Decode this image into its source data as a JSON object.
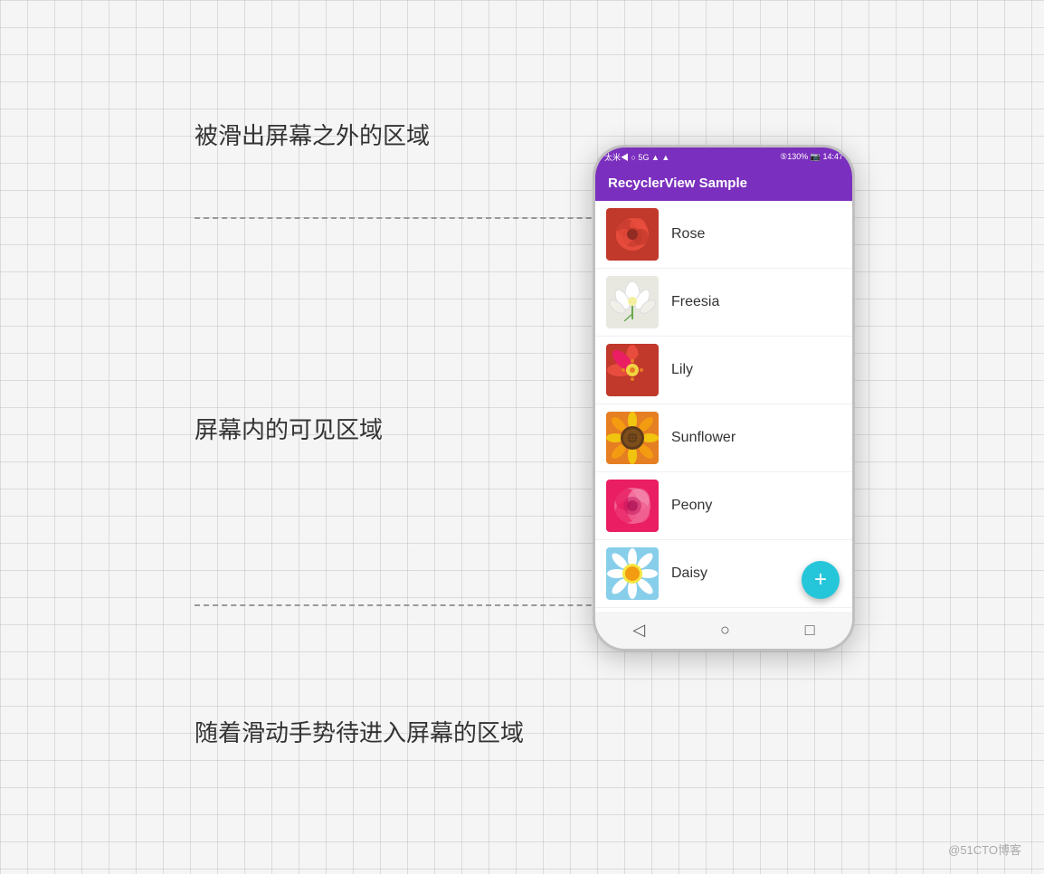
{
  "labels": {
    "top": "被滑出屏幕之外的区域",
    "middle": "屏幕内的可见区域",
    "bottom": "随着滑动手势待进入屏幕的区域",
    "watermark": "@51CTO博客"
  },
  "phone": {
    "status_bar": {
      "left": "太米◀ ○ 5G ▲ ▲",
      "right": "⑤130% 📷 14:47"
    },
    "toolbar_title": "RecyclerView Sample",
    "flowers": [
      {
        "name": "Rose",
        "color_class": "thumb-rose"
      },
      {
        "name": "Freesia",
        "color_class": "thumb-freesia"
      },
      {
        "name": "Lily",
        "color_class": "thumb-lily"
      },
      {
        "name": "Sunflower",
        "color_class": "thumb-sunflower"
      },
      {
        "name": "Peony",
        "color_class": "thumb-peony"
      },
      {
        "name": "Daisy",
        "color_class": "thumb-daisy"
      }
    ],
    "fab_icon": "+",
    "nav_icons": [
      "◁",
      "○",
      "□"
    ]
  },
  "colors": {
    "purple": "#7b2fbe",
    "teal": "#26c6da",
    "grid_bg": "#f5f5f5"
  }
}
